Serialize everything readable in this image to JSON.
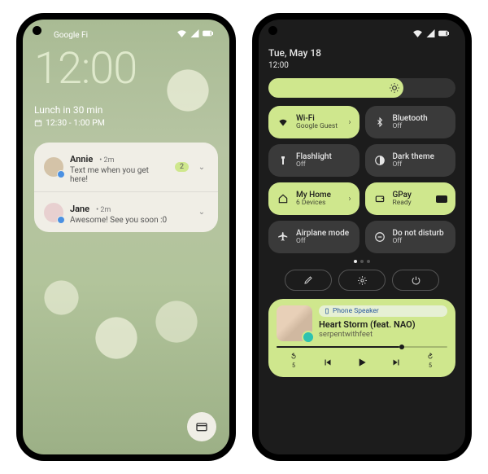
{
  "lock": {
    "carrier": "Google Fi",
    "clock": "12:00",
    "event_title": "Lunch in 30 min",
    "event_time": "12:30 - 1:00 PM",
    "notifs": [
      {
        "name": "Annie",
        "age": "2m",
        "body": "Text me when you get here!",
        "count": "2"
      },
      {
        "name": "Jane",
        "age": "2m",
        "body": "Awesome! See you soon :0"
      }
    ]
  },
  "qs": {
    "date": "Tue, May 18",
    "clock": "12:00",
    "brightness_pct": 72,
    "tiles": [
      {
        "icon": "wifi",
        "title": "Wi-Fi",
        "sub": "Google Guest",
        "on": true,
        "expand": true
      },
      {
        "icon": "bluetooth",
        "title": "Bluetooth",
        "sub": "Off",
        "on": false
      },
      {
        "icon": "flash",
        "title": "Flashlight",
        "sub": "Off",
        "on": false
      },
      {
        "icon": "darktheme",
        "title": "Dark theme",
        "sub": "Off",
        "on": false
      },
      {
        "icon": "home",
        "title": "My Home",
        "sub": "6 Devices",
        "on": true,
        "expand": true
      },
      {
        "icon": "gpay",
        "title": "GPay",
        "sub": "Ready",
        "on": true,
        "card": true
      },
      {
        "icon": "airplane",
        "title": "Airplane mode",
        "sub": "Off",
        "on": false
      },
      {
        "icon": "dnd",
        "title": "Do not disturb",
        "sub": "Off",
        "on": false
      }
    ],
    "media": {
      "output": "Phone Speaker",
      "title": "Heart Storm (feat. NAO)",
      "artist": "serpentwithfeet",
      "progress_pct": 72,
      "back_sec": "5",
      "fwd_sec": "5"
    }
  }
}
